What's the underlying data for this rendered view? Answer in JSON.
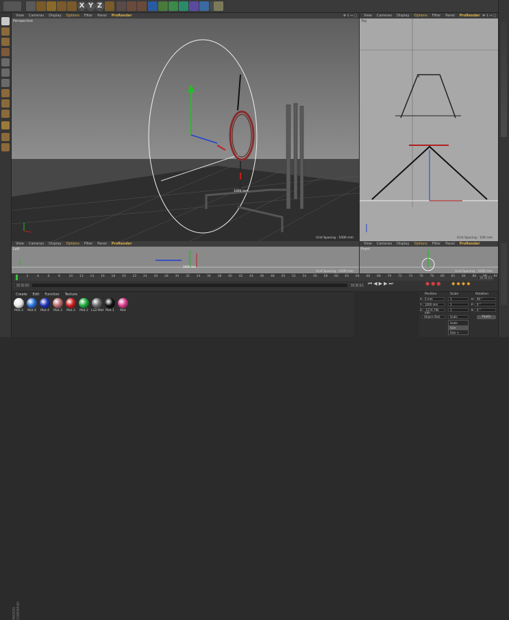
{
  "top_menu": {
    "viewport_menus": [
      "View",
      "Cameras",
      "Display",
      "Options",
      "Filter",
      "Panel",
      "ProRender"
    ]
  },
  "toolbar": {
    "axis_buttons": [
      "X",
      "Y",
      "Z"
    ]
  },
  "viewports": {
    "perspective": {
      "label": "Perspective",
      "grid": "Grid Spacing : 1000 mm",
      "measure": "1000 mm"
    },
    "top": {
      "label": "Top",
      "grid": "Grid Spacing : 100 mm"
    },
    "left": {
      "label": "Left",
      "grid": "Grid Spacing : 1000 mm",
      "measure": "1000 mm"
    },
    "front": {
      "label": "Front",
      "grid": "Grid Spacing : 1000 mm"
    }
  },
  "timeline": {
    "ticks": [
      "0",
      "2",
      "4",
      "6",
      "8",
      "10",
      "12",
      "14",
      "16",
      "18",
      "20",
      "22",
      "24",
      "26",
      "28",
      "30",
      "32",
      "34",
      "36",
      "38",
      "40",
      "42",
      "44",
      "46",
      "48",
      "50",
      "52",
      "54",
      "56",
      "58",
      "60",
      "62",
      "64",
      "66",
      "68",
      "70",
      "72",
      "74",
      "76",
      "78",
      "80",
      "82",
      "84",
      "86",
      "88",
      "90"
    ],
    "start_field": "00:00:00",
    "end_field": "00:00:03",
    "current_field": "00:00:00",
    "end_frame": "00:00:03"
  },
  "materials": {
    "menu": [
      "Create",
      "Edit",
      "Function",
      "Texture"
    ],
    "items": [
      {
        "label": "Mat.3",
        "color": "#e8e8e8"
      },
      {
        "label": "Mat.4",
        "color": "#2a6fd6"
      },
      {
        "label": "Mat.4",
        "color": "#1e2fb8"
      },
      {
        "label": "Mat.3",
        "color": "#b86a6a"
      },
      {
        "label": "Mat.2",
        "color": "#cc1e1e"
      },
      {
        "label": "Mat.2",
        "color": "#1fa83a"
      },
      {
        "label": "LLD.Mat",
        "color": "#6a6a6a"
      },
      {
        "label": "Mat.1",
        "color": "#111111"
      },
      {
        "label": "Mat",
        "color": "#d63a8a"
      }
    ]
  },
  "coordinates": {
    "headers": [
      "Position",
      "Scale",
      "Rotation"
    ],
    "rows": [
      {
        "axis": "X",
        "pos": "0 mm",
        "scale": "1",
        "rot_label": "H",
        "rot": "90 °"
      },
      {
        "axis": "Y",
        "pos": "1000 mm",
        "scale": "1",
        "rot_label": "P",
        "rot": "0 °"
      },
      {
        "axis": "Z",
        "pos": "-1274.790 mm",
        "scale": "1",
        "rot_label": "B",
        "rot": "0 °"
      }
    ],
    "mode_select": "Object (Rel)",
    "scale_select": "Scale",
    "dropdown_options": [
      "Scale",
      "Size",
      "Size +"
    ],
    "apply": "Apply"
  },
  "watermark": "MAXON CINEMA4D"
}
